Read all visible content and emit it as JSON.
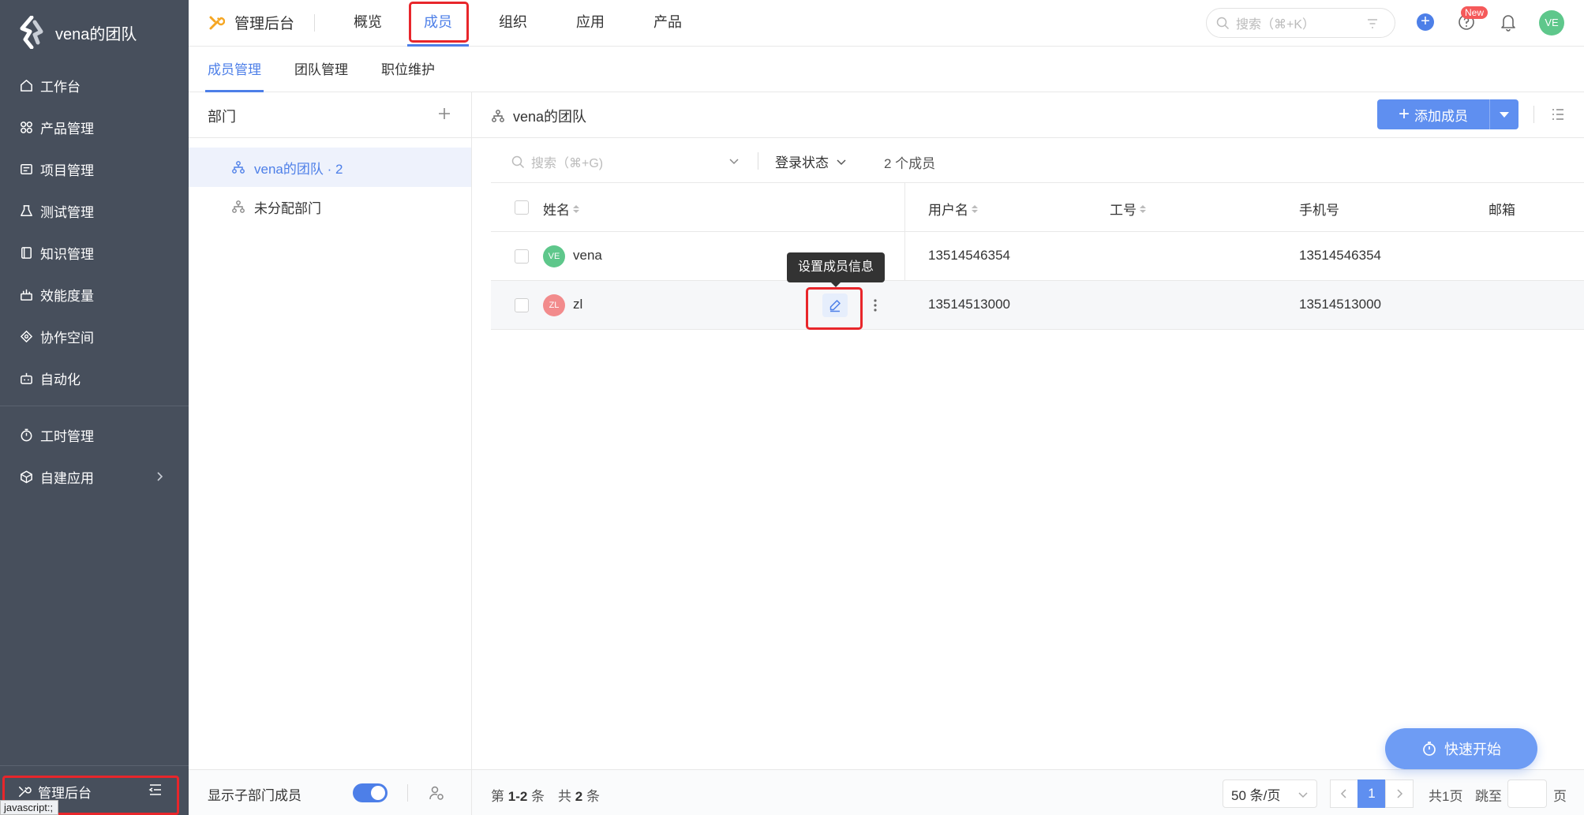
{
  "sidebar": {
    "brand": "vena的团队",
    "items": [
      {
        "label": "工作台",
        "icon": "home-icon"
      },
      {
        "label": "产品管理",
        "icon": "grid-icon"
      },
      {
        "label": "项目管理",
        "icon": "project-icon"
      },
      {
        "label": "测试管理",
        "icon": "flask-icon"
      },
      {
        "label": "知识管理",
        "icon": "book-icon"
      },
      {
        "label": "效能度量",
        "icon": "chart-icon"
      },
      {
        "label": "协作空间",
        "icon": "diamond-icon"
      },
      {
        "label": "自动化",
        "icon": "robot-icon"
      }
    ],
    "items2": [
      {
        "label": "工时管理",
        "icon": "timer-icon"
      },
      {
        "label": "自建应用",
        "icon": "cube-icon"
      }
    ],
    "bottom": {
      "label": "管理后台"
    },
    "status_url": "javascript:;"
  },
  "topbar": {
    "title": "管理后台",
    "tabs": [
      "概览",
      "成员",
      "组织",
      "应用",
      "产品"
    ],
    "active_tab": "成员",
    "search_placeholder": "搜索（⌘+K）",
    "new_badge": "New",
    "avatar_initials": "VE"
  },
  "subtabs": [
    "成员管理",
    "团队管理",
    "职位维护"
  ],
  "departments": {
    "header": "部门",
    "items": [
      {
        "label": "vena的团队 · 2",
        "selected": true
      },
      {
        "label": "未分配部门",
        "selected": false
      }
    ],
    "footer_label": "显示子部门成员"
  },
  "main": {
    "title": "vena的团队",
    "add_button": "添加成员",
    "search_placeholder": "搜索（⌘+G)",
    "login_status": "登录状态",
    "member_count": "2 个成员",
    "columns": [
      "姓名",
      "用户名",
      "工号",
      "手机号",
      "邮箱"
    ],
    "rows": [
      {
        "initials": "VE",
        "name": "vena",
        "username": "13514546354",
        "employee_id": "",
        "phone": "13514546354",
        "email": "",
        "avatar_color": "#5ec78b"
      },
      {
        "initials": "ZL",
        "name": "zl",
        "username": "13514513000",
        "employee_id": "",
        "phone": "13514513000",
        "email": "",
        "avatar_color": "#f28b8c"
      }
    ],
    "tooltip": "设置成员信息",
    "quick_start": "快速开始"
  },
  "pager": {
    "prefix": "第",
    "range": "1-2",
    "mid": "条　共",
    "total": "2",
    "suffix": "条",
    "page_size": "50 条/页",
    "current_page": "1",
    "total_pages": "共1页",
    "jump_label": "跳至",
    "jump_suffix": "页"
  },
  "colors": {
    "accent": "#4d7fe8",
    "sidebar_bg": "#474f5c",
    "highlight": "#e8262b"
  }
}
